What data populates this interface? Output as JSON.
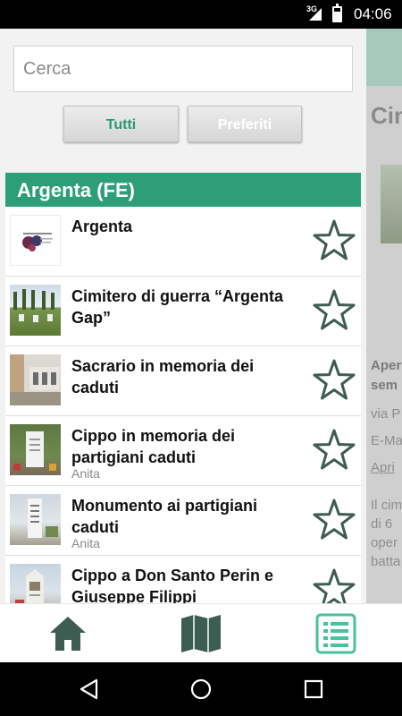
{
  "status_bar": {
    "network": "3G",
    "time": "04:06",
    "battery_level": 0.7
  },
  "background_page": {
    "title": "Cim",
    "lines": [
      "Aper",
      "sem",
      "via P",
      "E-Ma",
      "Apri",
      "Il cim",
      "di 6",
      "oper",
      "batta"
    ]
  },
  "drawer": {
    "search": {
      "placeholder": "Cerca",
      "value": ""
    },
    "tabs": {
      "all_label": "Tutti",
      "favorites_label": "Preferiti"
    },
    "section_title": "Argenta (FE)",
    "items": [
      {
        "title": "Argenta",
        "subtitle": "",
        "thumb": "logo",
        "favorite": false
      },
      {
        "title": "Cimitero di guerra “Argenta Gap”",
        "subtitle": "",
        "thumb": "cemetery",
        "favorite": false
      },
      {
        "title": "Sacrario in memoria dei caduti",
        "subtitle": "",
        "thumb": "sacrario",
        "favorite": false
      },
      {
        "title": "Cippo in memoria dei partigiani caduti",
        "subtitle": "Anita",
        "thumb": "cippo",
        "favorite": false
      },
      {
        "title": "Monumento ai partigiani caduti",
        "subtitle": "Anita",
        "thumb": "monument",
        "favorite": false
      },
      {
        "title": "Cippo a Don Santo Perin e Giuseppe Filippi",
        "subtitle": "",
        "thumb": "cippo2",
        "favorite": false
      }
    ]
  },
  "bottom_bar": {
    "icons": [
      "home-icon",
      "map-icon",
      "list-icon"
    ],
    "active": "list-icon"
  },
  "system_nav": {
    "icons": [
      "back-icon",
      "home-circle-icon",
      "recents-icon"
    ]
  },
  "colors": {
    "accent": "#2e9e78",
    "icon": "#3d5c52",
    "active_icon": "#48c29a",
    "star_stroke": "#3d5c52"
  }
}
